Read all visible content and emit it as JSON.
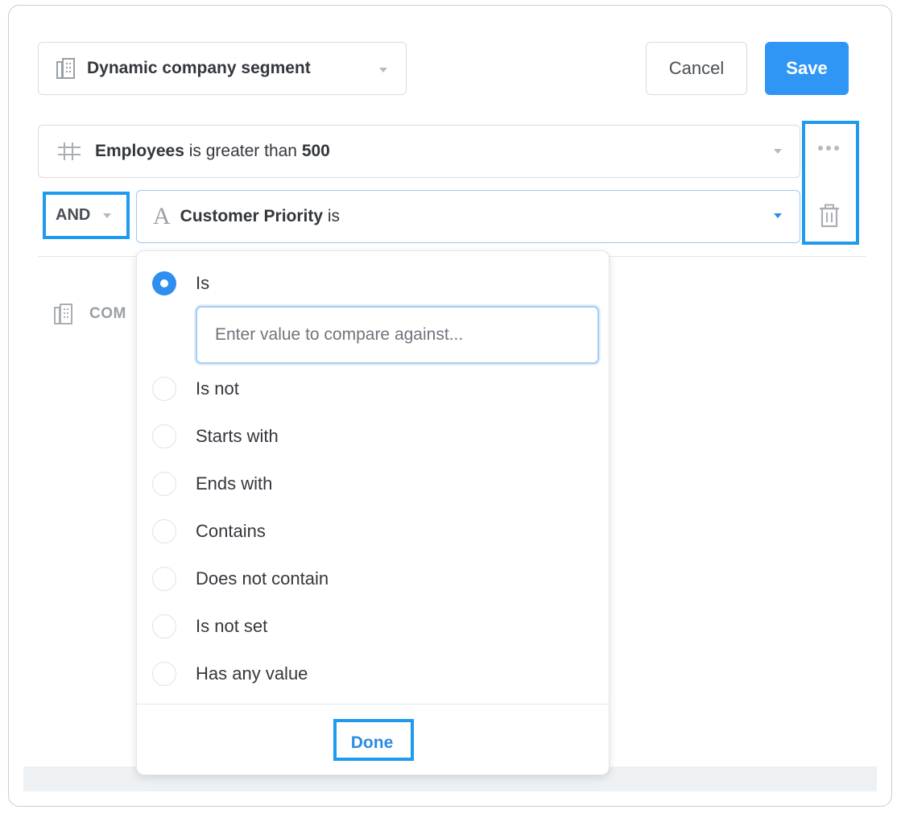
{
  "header": {
    "segment_label": "Dynamic company segment",
    "segment_icon": "building-icon",
    "cancel_label": "Cancel",
    "save_label": "Save"
  },
  "filters": [
    {
      "icon": "hash-icon",
      "field": "Employees",
      "operator": "is greater than",
      "value": "500"
    },
    {
      "icon": "text-type-icon",
      "icon_glyph": "A",
      "field": "Customer Priority",
      "operator": "is"
    }
  ],
  "conjunction": "AND",
  "row_actions": [
    "more-icon",
    "trash-icon"
  ],
  "background_row": {
    "icon": "building-icon",
    "label_visible": "COM"
  },
  "dropdown": {
    "options": [
      {
        "label": "Is",
        "selected": true
      },
      {
        "label": "Is not",
        "selected": false
      },
      {
        "label": "Starts with",
        "selected": false
      },
      {
        "label": "Ends with",
        "selected": false
      },
      {
        "label": "Contains",
        "selected": false
      },
      {
        "label": "Does not contain",
        "selected": false
      },
      {
        "label": "Is not set",
        "selected": false
      },
      {
        "label": "Has any value",
        "selected": false
      }
    ],
    "value_input": {
      "value": "",
      "placeholder": "Enter value to compare against..."
    },
    "done_label": "Done"
  },
  "colors": {
    "accent": "#3096f5",
    "highlight": "#1f9aef",
    "text": "#33373c",
    "muted": "#9aa0a7"
  }
}
